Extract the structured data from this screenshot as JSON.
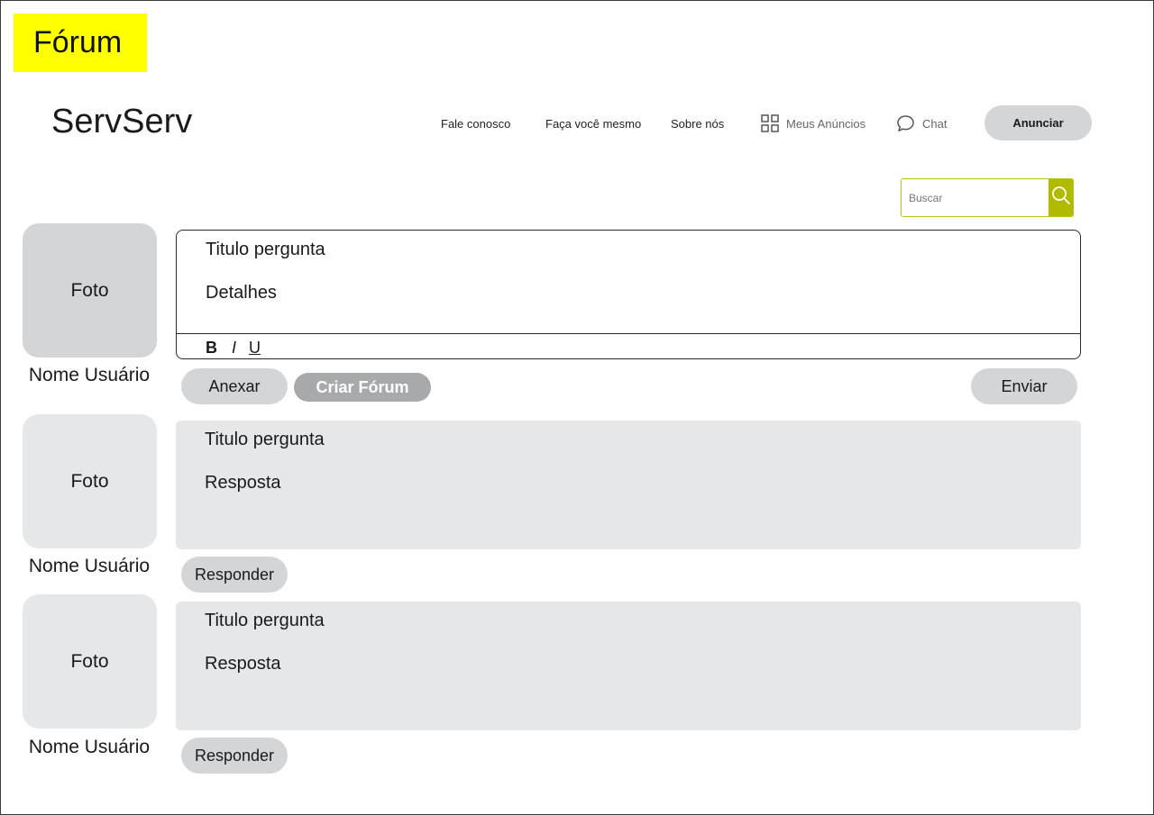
{
  "page_label": "Fórum",
  "header": {
    "brand": "ServServ",
    "nav": {
      "contact": "Fale conosco",
      "diy": "Faça você mesmo",
      "about": "Sobre nós",
      "my_ads": "Meus Anúncios",
      "chat": "Chat"
    },
    "announce_label": "Anunciar"
  },
  "search": {
    "placeholder": "Buscar"
  },
  "composer": {
    "avatar": "Foto",
    "username": "Nome Usuário",
    "title": "Titulo pergunta",
    "details": "Detalhes",
    "format": {
      "bold": "B",
      "italic": "I",
      "underline": "U"
    },
    "attach_label": "Anexar",
    "create_label": "Criar Fórum",
    "send_label": "Enviar"
  },
  "posts": [
    {
      "avatar": "Foto",
      "username": "Nome Usuário",
      "title": "Titulo pergunta",
      "answer": "Resposta",
      "reply_label": "Responder"
    },
    {
      "avatar": "Foto",
      "username": "Nome Usuário",
      "title": "Titulo pergunta",
      "answer": "Resposta",
      "reply_label": "Responder"
    }
  ],
  "colors": {
    "highlight": "#ffff00",
    "search_accent": "#b0bb00",
    "pill": "#d4d5d7",
    "card": "#e6e7e9"
  }
}
